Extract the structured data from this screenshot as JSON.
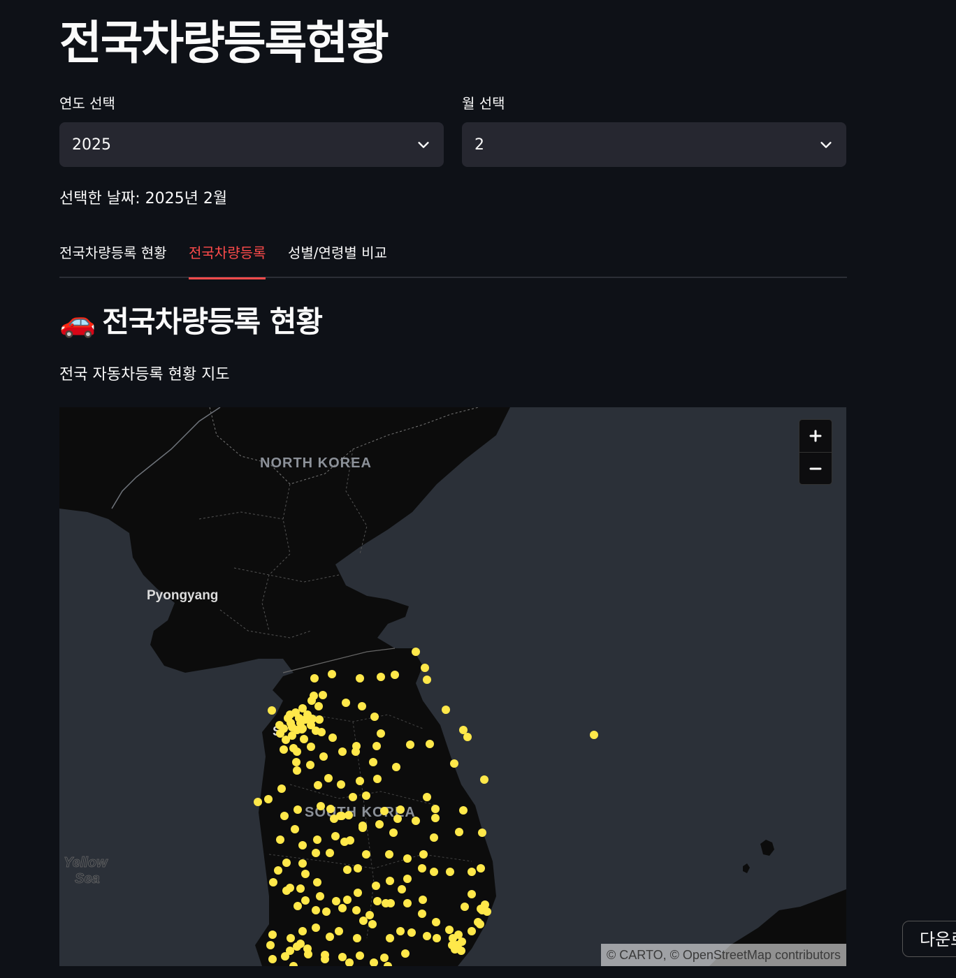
{
  "page": {
    "title": "전국차량등록현황"
  },
  "filters": {
    "year_label": "연도 선택",
    "year_value": "2025",
    "month_label": "월 선택",
    "month_value": "2"
  },
  "selected_date_text": "선택한 날짜: 2025년 2월",
  "tabs": [
    {
      "label": "전국차량등록 현황",
      "active": false
    },
    {
      "label": "전국차량등록",
      "active": true
    },
    {
      "label": "성별/연령별 비교",
      "active": false
    }
  ],
  "section": {
    "emoji": "🚗",
    "title": "전국차량등록 현황",
    "caption": "전국 자동차등록 현황 지도"
  },
  "map": {
    "labels": {
      "north_korea": "NORTH KOREA",
      "pyongyang": "Pyongyang",
      "seoul": "S",
      "south_korea": "SOUTH KOREA",
      "yellow_sea_1": "Yellow",
      "yellow_sea_2": "Sea"
    },
    "zoom_in": "+",
    "zoom_out": "−",
    "attribution": "© CARTO, © OpenStreetMap contributors",
    "point_color": "#ffe84a",
    "land_color": "#0c0c0c",
    "sea_color": "#2b3038"
  },
  "download_button": "다운로"
}
